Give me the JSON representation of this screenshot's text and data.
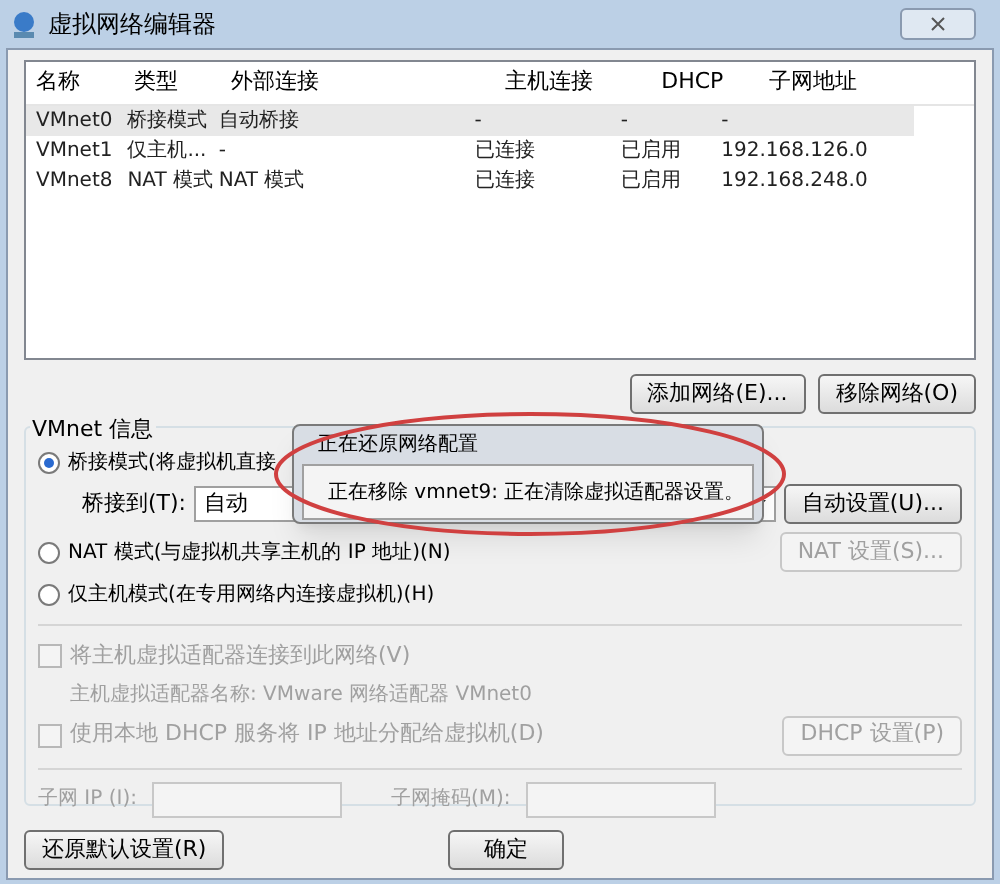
{
  "window": {
    "title": "虚拟网络编辑器"
  },
  "table": {
    "columns": [
      "名称",
      "类型",
      "外部连接",
      "主机连接",
      "DHCP",
      "子网地址"
    ],
    "rows": [
      {
        "cells": [
          "VMnet0",
          "桥接模式",
          "自动桥接",
          "-",
          "-",
          "-"
        ],
        "selected": true
      },
      {
        "cells": [
          "VMnet1",
          "仅主机...",
          "-",
          "已连接",
          "已启用",
          "192.168.126.0"
        ],
        "selected": false
      },
      {
        "cells": [
          "VMnet8",
          "NAT 模式",
          "NAT 模式",
          "已连接",
          "已启用",
          "192.168.248.0"
        ],
        "selected": false
      }
    ]
  },
  "list_buttons": [
    "添加网络(E)...",
    "移除网络(O)"
  ],
  "info": {
    "title": "VMnet 信息",
    "modes": [
      {
        "label": "桥接模式(将虚拟机直接",
        "selected": true
      },
      {
        "label": "NAT 模式(与虚拟机共享主机的 IP 地址)(N)",
        "selected": false
      },
      {
        "label": "仅主机模式(在专用网络内连接虚拟机)(H)",
        "selected": false
      }
    ],
    "bridge_label": "桥接到(T):",
    "bridge_value": "自动",
    "auto_button": "自动设置(U)...",
    "nat_button": "NAT 设置(S)...",
    "connect_adapter": {
      "label": "将主机虚拟适配器连接到此网络(V)",
      "checked": false,
      "disabled": true
    },
    "adapter_name": "主机虚拟适配器名称: VMware 网络适配器 VMnet0",
    "dhcp": {
      "label": "使用本地 DHCP 服务将 IP 地址分配给虚拟机(D)",
      "checked": false,
      "disabled": true
    },
    "dhcp_button": "DHCP 设置(P)",
    "subnet_ip_label": "子网 IP (I):",
    "subnet_mask_label": "子网掩码(M):"
  },
  "footer": {
    "restore_button": "还原默认设置(R)",
    "ok_button": "确定"
  },
  "progress_dialog": {
    "title": "正在还原网络配置",
    "message": "正在移除 vmnet9: 正在清除虚拟适配器设置。"
  }
}
